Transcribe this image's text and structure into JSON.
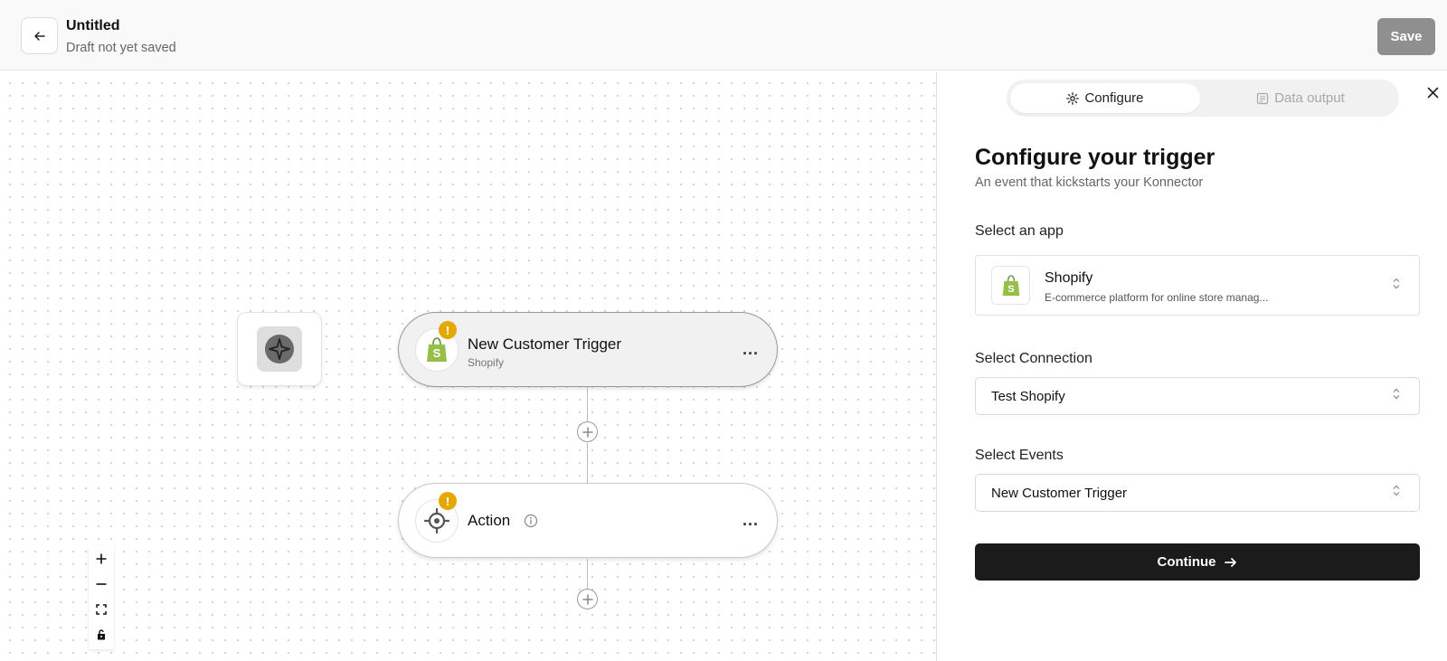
{
  "header": {
    "title": "Untitled",
    "subtitle": "Draft not yet saved",
    "save_label": "Save"
  },
  "canvas": {
    "trigger_node": {
      "title": "New Customer Trigger",
      "subtitle": "Shopify",
      "warning": "!",
      "more": "..."
    },
    "action_node": {
      "title": "Action",
      "warning": "!",
      "more": "..."
    }
  },
  "panel": {
    "tabs": [
      {
        "label": "Configure",
        "active": true,
        "icon": "gear-icon"
      },
      {
        "label": "Data output",
        "active": false,
        "icon": "document-icon"
      }
    ],
    "title": "Configure your trigger",
    "description": "An event that kickstarts your Konnector",
    "app_label": "Select an app",
    "app": {
      "name": "Shopify",
      "description": "E-commerce platform for online store manag..."
    },
    "connection_label": "Select Connection",
    "connection_value": "Test Shopify",
    "events_label": "Select Events",
    "events_value": "New Customer Trigger",
    "continue_label": "Continue"
  },
  "colors": {
    "warning": "#e5a800",
    "shopify_green": "#95bf47",
    "primary_button": "#1b1b1b",
    "save_button": "#8f8f8f"
  }
}
